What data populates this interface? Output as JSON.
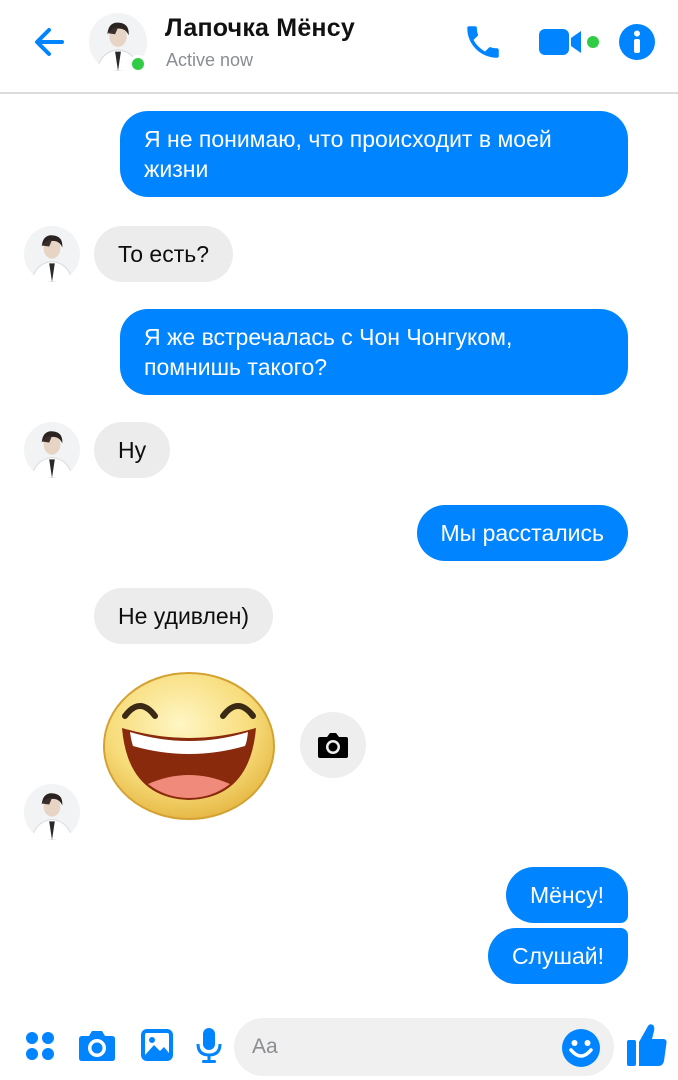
{
  "header": {
    "contact_name": "Лапочка Мёнсу",
    "status": "Active now"
  },
  "messages": [
    {
      "direction": "outgoing",
      "text": "Я не понимаю, что происходит в моей жизни"
    },
    {
      "direction": "incoming",
      "text": "То есть?"
    },
    {
      "direction": "outgoing",
      "text": "Я же встречалась с Чон Чонгуком, помнишь такого?"
    },
    {
      "direction": "incoming",
      "text": "Ну"
    },
    {
      "direction": "outgoing",
      "text": "Мы расстались"
    },
    {
      "direction": "incoming",
      "text": "Не удивлен)"
    },
    {
      "direction": "incoming",
      "type": "sticker",
      "sticker": "laughing-face"
    },
    {
      "direction": "outgoing",
      "text": "Мёнсу!"
    },
    {
      "direction": "outgoing",
      "text": "Слушай!"
    }
  ],
  "composer": {
    "placeholder": "Aa"
  },
  "colors": {
    "accent": "#0084ff",
    "incoming_bubble": "#ececec",
    "online": "#31cc46"
  }
}
